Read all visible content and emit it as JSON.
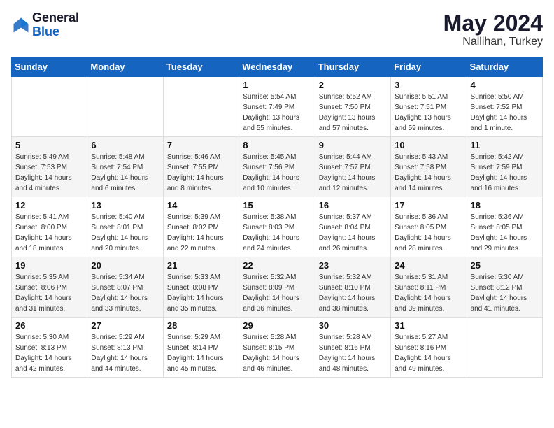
{
  "header": {
    "logo_line1": "General",
    "logo_line2": "Blue",
    "month": "May 2024",
    "location": "Nallihan, Turkey"
  },
  "days_of_week": [
    "Sunday",
    "Monday",
    "Tuesday",
    "Wednesday",
    "Thursday",
    "Friday",
    "Saturday"
  ],
  "weeks": [
    [
      {
        "day": "",
        "info": ""
      },
      {
        "day": "",
        "info": ""
      },
      {
        "day": "",
        "info": ""
      },
      {
        "day": "1",
        "info": "Sunrise: 5:54 AM\nSunset: 7:49 PM\nDaylight: 13 hours\nand 55 minutes."
      },
      {
        "day": "2",
        "info": "Sunrise: 5:52 AM\nSunset: 7:50 PM\nDaylight: 13 hours\nand 57 minutes."
      },
      {
        "day": "3",
        "info": "Sunrise: 5:51 AM\nSunset: 7:51 PM\nDaylight: 13 hours\nand 59 minutes."
      },
      {
        "day": "4",
        "info": "Sunrise: 5:50 AM\nSunset: 7:52 PM\nDaylight: 14 hours\nand 1 minute."
      }
    ],
    [
      {
        "day": "5",
        "info": "Sunrise: 5:49 AM\nSunset: 7:53 PM\nDaylight: 14 hours\nand 4 minutes."
      },
      {
        "day": "6",
        "info": "Sunrise: 5:48 AM\nSunset: 7:54 PM\nDaylight: 14 hours\nand 6 minutes."
      },
      {
        "day": "7",
        "info": "Sunrise: 5:46 AM\nSunset: 7:55 PM\nDaylight: 14 hours\nand 8 minutes."
      },
      {
        "day": "8",
        "info": "Sunrise: 5:45 AM\nSunset: 7:56 PM\nDaylight: 14 hours\nand 10 minutes."
      },
      {
        "day": "9",
        "info": "Sunrise: 5:44 AM\nSunset: 7:57 PM\nDaylight: 14 hours\nand 12 minutes."
      },
      {
        "day": "10",
        "info": "Sunrise: 5:43 AM\nSunset: 7:58 PM\nDaylight: 14 hours\nand 14 minutes."
      },
      {
        "day": "11",
        "info": "Sunrise: 5:42 AM\nSunset: 7:59 PM\nDaylight: 14 hours\nand 16 minutes."
      }
    ],
    [
      {
        "day": "12",
        "info": "Sunrise: 5:41 AM\nSunset: 8:00 PM\nDaylight: 14 hours\nand 18 minutes."
      },
      {
        "day": "13",
        "info": "Sunrise: 5:40 AM\nSunset: 8:01 PM\nDaylight: 14 hours\nand 20 minutes."
      },
      {
        "day": "14",
        "info": "Sunrise: 5:39 AM\nSunset: 8:02 PM\nDaylight: 14 hours\nand 22 minutes."
      },
      {
        "day": "15",
        "info": "Sunrise: 5:38 AM\nSunset: 8:03 PM\nDaylight: 14 hours\nand 24 minutes."
      },
      {
        "day": "16",
        "info": "Sunrise: 5:37 AM\nSunset: 8:04 PM\nDaylight: 14 hours\nand 26 minutes."
      },
      {
        "day": "17",
        "info": "Sunrise: 5:36 AM\nSunset: 8:05 PM\nDaylight: 14 hours\nand 28 minutes."
      },
      {
        "day": "18",
        "info": "Sunrise: 5:36 AM\nSunset: 8:05 PM\nDaylight: 14 hours\nand 29 minutes."
      }
    ],
    [
      {
        "day": "19",
        "info": "Sunrise: 5:35 AM\nSunset: 8:06 PM\nDaylight: 14 hours\nand 31 minutes."
      },
      {
        "day": "20",
        "info": "Sunrise: 5:34 AM\nSunset: 8:07 PM\nDaylight: 14 hours\nand 33 minutes."
      },
      {
        "day": "21",
        "info": "Sunrise: 5:33 AM\nSunset: 8:08 PM\nDaylight: 14 hours\nand 35 minutes."
      },
      {
        "day": "22",
        "info": "Sunrise: 5:32 AM\nSunset: 8:09 PM\nDaylight: 14 hours\nand 36 minutes."
      },
      {
        "day": "23",
        "info": "Sunrise: 5:32 AM\nSunset: 8:10 PM\nDaylight: 14 hours\nand 38 minutes."
      },
      {
        "day": "24",
        "info": "Sunrise: 5:31 AM\nSunset: 8:11 PM\nDaylight: 14 hours\nand 39 minutes."
      },
      {
        "day": "25",
        "info": "Sunrise: 5:30 AM\nSunset: 8:12 PM\nDaylight: 14 hours\nand 41 minutes."
      }
    ],
    [
      {
        "day": "26",
        "info": "Sunrise: 5:30 AM\nSunset: 8:13 PM\nDaylight: 14 hours\nand 42 minutes."
      },
      {
        "day": "27",
        "info": "Sunrise: 5:29 AM\nSunset: 8:13 PM\nDaylight: 14 hours\nand 44 minutes."
      },
      {
        "day": "28",
        "info": "Sunrise: 5:29 AM\nSunset: 8:14 PM\nDaylight: 14 hours\nand 45 minutes."
      },
      {
        "day": "29",
        "info": "Sunrise: 5:28 AM\nSunset: 8:15 PM\nDaylight: 14 hours\nand 46 minutes."
      },
      {
        "day": "30",
        "info": "Sunrise: 5:28 AM\nSunset: 8:16 PM\nDaylight: 14 hours\nand 48 minutes."
      },
      {
        "day": "31",
        "info": "Sunrise: 5:27 AM\nSunset: 8:16 PM\nDaylight: 14 hours\nand 49 minutes."
      },
      {
        "day": "",
        "info": ""
      }
    ]
  ]
}
